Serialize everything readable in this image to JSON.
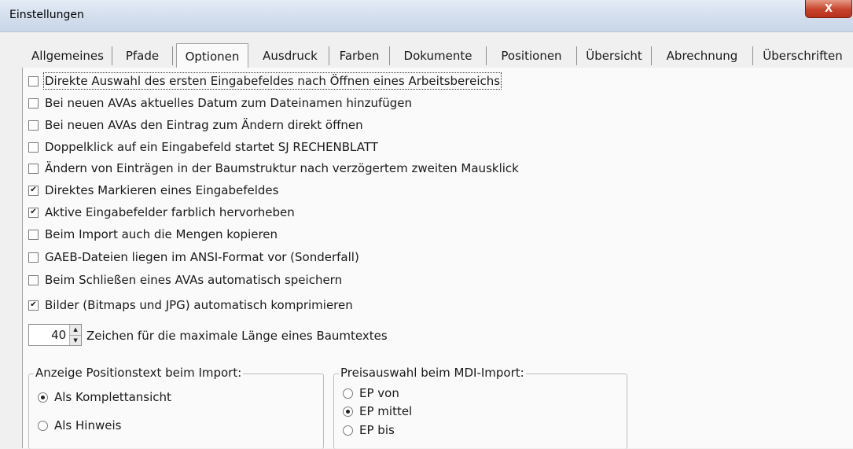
{
  "window": {
    "title": "Einstellungen",
    "close_label": "X"
  },
  "tabs": [
    {
      "label": "Allgemeines"
    },
    {
      "label": "Pfade"
    },
    {
      "label": "Optionen"
    },
    {
      "label": "Ausdruck"
    },
    {
      "label": "Farben"
    },
    {
      "label": "Dokumente"
    },
    {
      "label": "Positionen"
    },
    {
      "label": "Übersicht"
    },
    {
      "label": "Abrechnung"
    },
    {
      "label": "Überschriften"
    }
  ],
  "active_tab": "Optionen",
  "options": [
    {
      "label": "Direkte Auswahl des ersten Eingabefeldes nach Öffnen eines Arbeitsbereichs",
      "checked": false
    },
    {
      "label": "Bei neuen AVAs aktuelles Datum zum Dateinamen hinzufügen",
      "checked": false
    },
    {
      "label": "Bei neuen AVAs den Eintrag zum Ändern direkt öffnen",
      "checked": false
    },
    {
      "label": "Doppelklick auf ein Eingabefeld startet SJ RECHENBLATT",
      "checked": false
    },
    {
      "label": "Ändern von Einträgen in der Baumstruktur nach verzögertem zweiten Mausklick",
      "checked": false
    },
    {
      "label": "Direktes Markieren eines Eingabefeldes",
      "checked": true
    },
    {
      "label": "Aktive Eingabefelder farblich hervorheben",
      "checked": true
    },
    {
      "label": "Beim Import auch die Mengen kopieren",
      "checked": false
    },
    {
      "label": "GAEB-Dateien liegen im ANSI-Format vor (Sonderfall)",
      "checked": false
    },
    {
      "label": "Beim Schließen eines AVAs automatisch speichern",
      "checked": false
    },
    {
      "label": "Bilder (Bitmaps und JPG) automatisch komprimieren",
      "checked": true
    }
  ],
  "spinner": {
    "value": "40",
    "label": "Zeichen für die maximale Länge eines Baumtextes"
  },
  "group_positionstext": {
    "legend": "Anzeige Positionstext beim Import:",
    "options": [
      {
        "label": "Als Komplettansicht",
        "selected": true
      },
      {
        "label": "Als Hinweis",
        "selected": false
      }
    ]
  },
  "group_preisauswahl": {
    "legend": "Preisauswahl beim MDI-Import:",
    "options": [
      {
        "label": "EP von",
        "selected": false
      },
      {
        "label": "EP mittel",
        "selected": true
      },
      {
        "label": "EP bis",
        "selected": false
      }
    ]
  },
  "colors": {
    "titlebar": "#d3deed",
    "close_button": "#c8432b",
    "panel": "#fafafa"
  }
}
